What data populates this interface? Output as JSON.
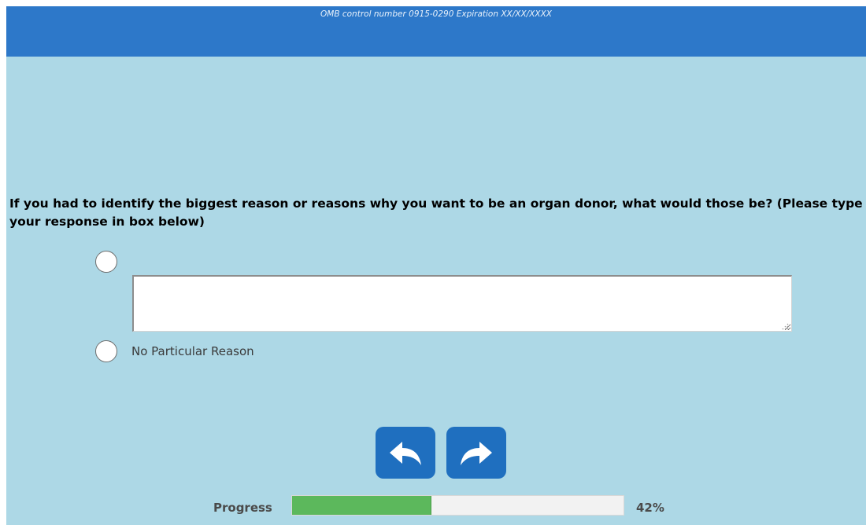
{
  "header": {
    "omb_notice": "OMB control number 0915-0290 Expiration XX/XX/XXXX",
    "background_color": "#2d78c9"
  },
  "question": {
    "text": "If you had to identify the biggest reason or reasons why you want to be an organ donor, what would those be? (Please type your response in box below)"
  },
  "options": [
    {
      "label": "",
      "type": "radio-with-text",
      "selected": false,
      "response_value": ""
    },
    {
      "label": "No Particular Reason",
      "type": "radio",
      "selected": false
    }
  ],
  "navigation": {
    "back_icon": "back-arrow-icon",
    "next_icon": "forward-arrow-icon",
    "button_color": "#1f6fbf"
  },
  "progress": {
    "label": "Progress",
    "value": 0.42,
    "percent_text": "42%",
    "fill_color": "#5cb85c"
  },
  "theme": {
    "page_background": "#add8e6"
  }
}
